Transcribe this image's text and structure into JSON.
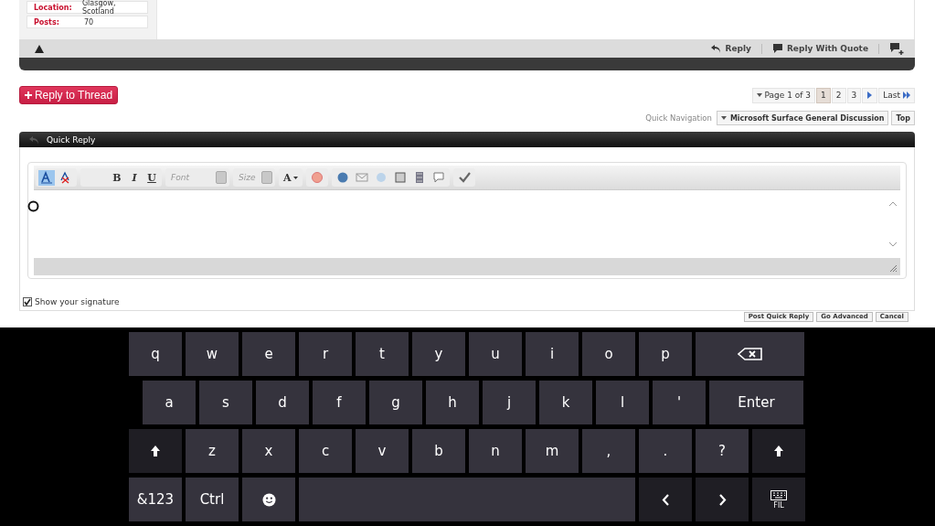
{
  "post": {
    "info": [
      {
        "label": "Location:",
        "value": "Glasgow, Scotland"
      },
      {
        "label": "Posts:",
        "value": "70"
      }
    ],
    "actions": [
      {
        "label": "Reply"
      },
      {
        "label": "Reply With Quote"
      }
    ]
  },
  "reply_button": "Reply to Thread",
  "pagination": {
    "label": "Page 1 of 3",
    "pages": [
      {
        "label": "1",
        "selected": true
      },
      {
        "label": "2",
        "selected": false
      },
      {
        "label": "3",
        "selected": false
      }
    ],
    "last": "Last"
  },
  "quick_navigation": {
    "label": "Quick Navigation",
    "forum": "Microsoft Surface General Discussion",
    "top": "Top"
  },
  "quick_reply": {
    "title": "Quick Reply",
    "toolbar": {
      "mode_toggle": {
        "selected": true
      },
      "format_buttons": [
        "B",
        "I",
        "U"
      ],
      "font": {
        "placeholder": "Font"
      },
      "size": {
        "placeholder": "Size"
      },
      "color_button": "A"
    },
    "show_signature": {
      "label": "Show your signature",
      "checked": true
    },
    "buttons": [
      "Post Quick Reply",
      "Go Advanced",
      "Cancel"
    ]
  },
  "keyboard": {
    "rows": [
      [
        {
          "kind": "char",
          "label": "q"
        },
        {
          "kind": "char",
          "label": "w"
        },
        {
          "kind": "char",
          "label": "e"
        },
        {
          "kind": "char",
          "label": "r"
        },
        {
          "kind": "char",
          "label": "t"
        },
        {
          "kind": "char",
          "label": "y"
        },
        {
          "kind": "char",
          "label": "u"
        },
        {
          "kind": "char",
          "label": "i"
        },
        {
          "kind": "char",
          "label": "o"
        },
        {
          "kind": "char",
          "label": "p"
        },
        {
          "kind": "backspace"
        }
      ],
      [
        {
          "kind": "char",
          "label": "a"
        },
        {
          "kind": "char",
          "label": "s"
        },
        {
          "kind": "char",
          "label": "d"
        },
        {
          "kind": "char",
          "label": "f"
        },
        {
          "kind": "char",
          "label": "g"
        },
        {
          "kind": "char",
          "label": "h"
        },
        {
          "kind": "char",
          "label": "j"
        },
        {
          "kind": "char",
          "label": "k"
        },
        {
          "kind": "char",
          "label": "l"
        },
        {
          "kind": "char",
          "label": "'"
        },
        {
          "kind": "enter",
          "label": "Enter"
        }
      ],
      [
        {
          "kind": "shift"
        },
        {
          "kind": "char",
          "label": "z"
        },
        {
          "kind": "char",
          "label": "x"
        },
        {
          "kind": "char",
          "label": "c"
        },
        {
          "kind": "char",
          "label": "v"
        },
        {
          "kind": "char",
          "label": "b"
        },
        {
          "kind": "char",
          "label": "n"
        },
        {
          "kind": "char",
          "label": "m"
        },
        {
          "kind": "char",
          "label": ","
        },
        {
          "kind": "char",
          "label": "."
        },
        {
          "kind": "char",
          "label": "?"
        },
        {
          "kind": "shift"
        }
      ],
      [
        {
          "kind": "char",
          "label": "&123"
        },
        {
          "kind": "char",
          "label": "Ctrl"
        },
        {
          "kind": "emoji"
        },
        {
          "kind": "space"
        },
        {
          "kind": "left"
        },
        {
          "kind": "right"
        },
        {
          "kind": "layout",
          "label": "FIL"
        }
      ]
    ]
  }
}
